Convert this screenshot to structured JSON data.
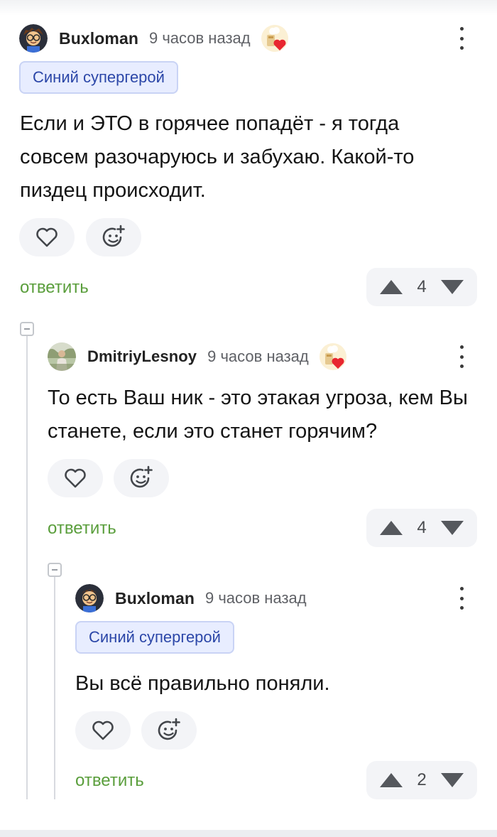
{
  "comments": [
    {
      "username": "Buxloman",
      "time": "9 часов назад",
      "badge": "Синий супергерой",
      "text": "Если и ЭТО в горячее попадёт - я тогда совсем разочаруюсь и забухаю. Какой-то пиздец происходит.",
      "reply_label": "ответить",
      "votes": "4"
    },
    {
      "username": "DmitriyLesnoy",
      "time": "9 часов назад",
      "text": "То есть Ваш ник - это этакая угроза, кем Вы станете, если это станет горячим?",
      "reply_label": "ответить",
      "votes": "4"
    },
    {
      "username": "Buxloman",
      "time": "9 часов назад",
      "badge": "Синий супергерой",
      "text": "Вы всё правильно поняли.",
      "reply_label": "ответить",
      "votes": "2"
    }
  ],
  "colors": {
    "reply_green": "#5a9e3c",
    "badge_text": "#2c47a8",
    "badge_bg": "#e8edff",
    "button_bg": "#f3f4f7"
  },
  "icons": [
    "avatar-buxloman",
    "avatar-dmitriylesnoy",
    "medal-heart-icon",
    "more-vertical-icon",
    "heart-icon",
    "emoji-add-icon",
    "arrow-up-icon",
    "arrow-down-icon",
    "collapse-icon"
  ]
}
